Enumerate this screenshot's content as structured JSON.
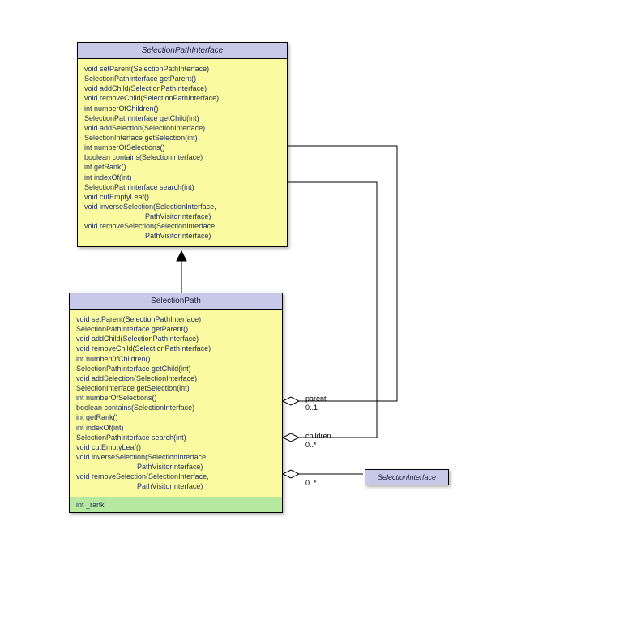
{
  "interface": {
    "title": "SelectionPathInterface",
    "methods": [
      "void setParent(SelectionPathInterface)",
      "SelectionPathInterface getParent()",
      "void addChild(SelectionPathInterface)",
      "void removeChild(SelectionPathInterface)",
      "int numberOfChildren()",
      "SelectionPathInterface getChild(int)",
      "void addSelection(SelectionInterface)",
      "SelectionInterface getSelection(int)",
      "int numberOfSelections()",
      "boolean contains(SelectionInterface)",
      "int getRank()",
      "int indexOf(int)",
      "SelectionPathInterface search(int)",
      "void cutEmptyLeaf()",
      "void inverseSelection(SelectionInterface,",
      "                              PathVisitorInterface)",
      "void removeSelection(SelectionInterface,",
      "                              PathVisitorInterface)"
    ]
  },
  "class": {
    "title": "SelectionPath",
    "methods": [
      "void setParent(SelectionPathInterface)",
      "SelectionPathInterface getParent()",
      "void addChild(SelectionPathInterface)",
      "void removeChild(SelectionPathInterface)",
      "int numberOfChildren()",
      "SelectionPathInterface getChild(int)",
      "void addSelection(SelectionInterface)",
      "SelectionInterface getSelection(int)",
      "int numberOfSelections()",
      "boolean contains(SelectionInterface)",
      "int getRank()",
      "int indexOf(int)",
      "SelectionPathInterface search(int)",
      "void cutEmptyLeaf()",
      "void inverseSelection(SelectionInterface,",
      "                              PathVisitorInterface)",
      "void removeSelection(SelectionInterface,",
      "                              PathVisitorInterface)"
    ],
    "attr": "int _rank"
  },
  "selInterface": {
    "title": "SelectionInterface"
  },
  "labels": {
    "parent": "parent",
    "parent_mult": "0..1",
    "children": "children",
    "children_mult": "0..*",
    "sel_mult": "0..*"
  }
}
